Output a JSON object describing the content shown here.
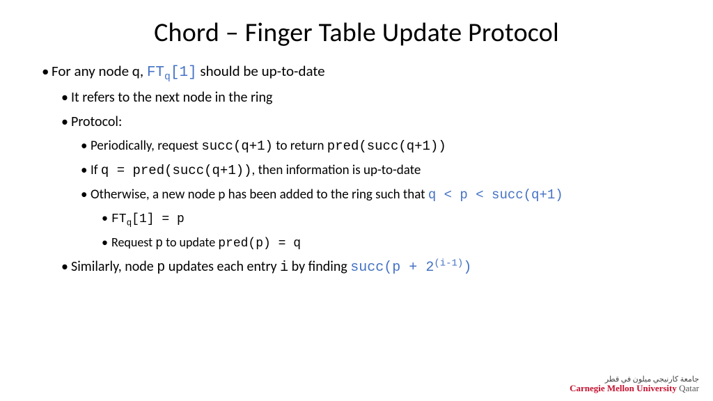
{
  "title": "Chord – Finger Table Update Protocol",
  "b1_pre": "For any node q, ",
  "b1_code": "FT",
  "b1_sub": "q",
  "b1_code2": "[1]",
  "b1_post": " should be up-to-date",
  "b2": "It refers to the next node in the ring",
  "b3": "Protocol:",
  "b4_pre": "Periodically, request ",
  "b4_c1": "succ(q+1)",
  "b4_mid": " to return ",
  "b4_c2": "pred(succ(q+1))",
  "b5_pre": "If ",
  "b5_c1": "q = pred(succ(q+1))",
  "b5_post": ", then information is up-to-date",
  "b6_pre": "Otherwise, a new node p has been added to the ring such that ",
  "b6_c1": "q < p < succ(q+1)",
  "b7_c1": "FT",
  "b7_sub": "q",
  "b7_c2": "[1] = p",
  "b8_pre": "Request ",
  "b8_c1": "p",
  "b8_mid": " to update ",
  "b8_c2": "pred(p) = q",
  "b9_pre": "Similarly, node ",
  "b9_c1": "p",
  "b9_mid": " updates each entry ",
  "b9_c2": "i",
  "b9_mid2": " by finding ",
  "b9_c3a": "succ(p + 2",
  "b9_sup": "(i-1)",
  "b9_c3b": ")",
  "logo_arabic": "جامعة كارنيجي ميلون في قطر",
  "logo_en1": "Carnegie Mellon University",
  "logo_en2": " Qatar"
}
